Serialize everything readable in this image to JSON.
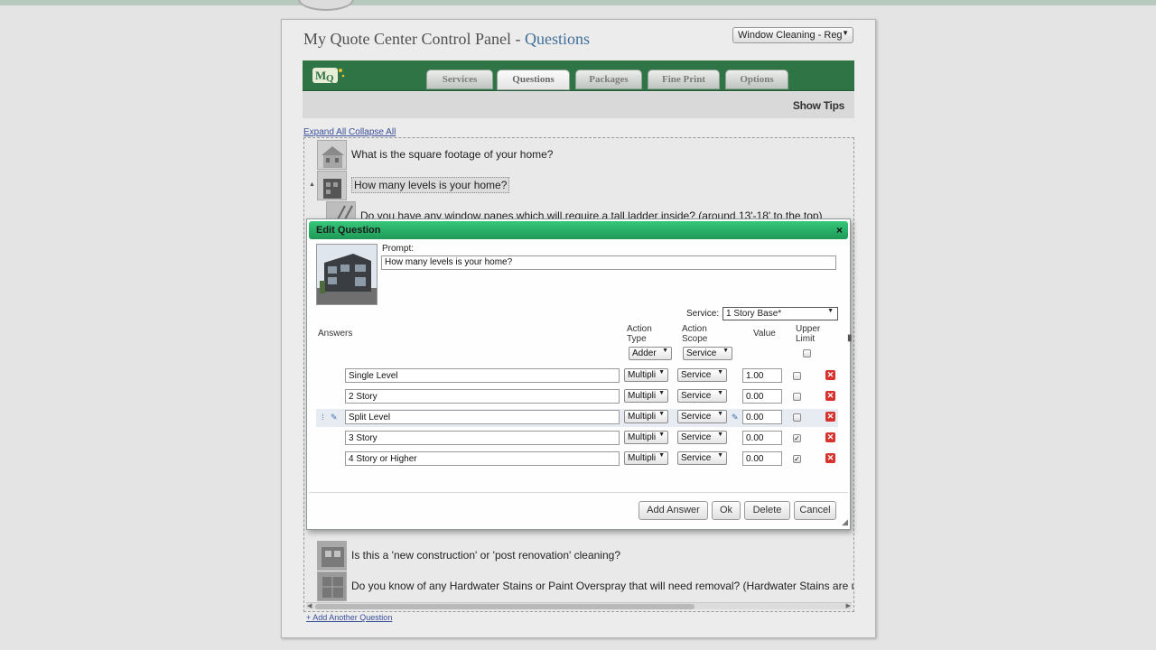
{
  "header": {
    "title_main": "My Quote Center Control Panel - ",
    "title_section": "Questions",
    "service_selector": "Window Cleaning - Reg"
  },
  "nav": {
    "tabs": [
      {
        "label": "Services"
      },
      {
        "label": "Questions",
        "active": true
      },
      {
        "label": "Packages"
      },
      {
        "label": "Fine Print"
      },
      {
        "label": "Options"
      }
    ],
    "show_tips": "Show Tips"
  },
  "list": {
    "expand_all": "Expand All",
    "collapse_all": "Collapse All",
    "questions": [
      "What is the square footage of your home?",
      "How many levels is your home?",
      "Do you have any window panes which will require a tall ladder inside? (around 13'-18' to the top)",
      "Is this a 'new construction' or 'post renovation' cleaning?",
      "Do you know of any Hardwater Stains or Paint Overspray that will need removal? (Hardwater Stains are u"
    ],
    "add_question": "+ Add Another Question"
  },
  "dialog": {
    "title": "Edit Question",
    "close": "×",
    "prompt_label": "Prompt:",
    "prompt_value": "How many levels is your home?",
    "service_label": "Service:",
    "service_value": "1 Story Base*",
    "headers": {
      "answers": "Answers",
      "action_type_1": "Action",
      "action_type_2": "Type",
      "action_scope_1": "Action",
      "action_scope_2": "Scope",
      "value": "Value",
      "upper_limit_1": "Upper",
      "upper_limit_2": "Limit"
    },
    "default_action_type": "Adder",
    "default_action_scope": "Service",
    "answers": [
      {
        "label": "Single Level",
        "type": "Multipli",
        "scope": "Service",
        "value": "1.00",
        "upper": false
      },
      {
        "label": "2 Story",
        "type": "Multipli",
        "scope": "Service",
        "value": "0.00",
        "upper": false
      },
      {
        "label": "Split Level",
        "type": "Multipli",
        "scope": "Service",
        "value": "0.00",
        "upper": false
      },
      {
        "label": "3 Story",
        "type": "Multipli",
        "scope": "Service",
        "value": "0.00",
        "upper": true
      },
      {
        "label": "4 Story or Higher",
        "type": "Multipli",
        "scope": "Service",
        "value": "0.00",
        "upper": true
      }
    ],
    "buttons": {
      "add_answer": "Add Answer",
      "ok": "Ok",
      "delete": "Delete",
      "cancel": "Cancel"
    }
  },
  "colors": {
    "nav_green": "#2f7444",
    "dialog_title_green": "#1e9957",
    "accent_blue": "#3f6f98",
    "delete_red": "#d8322e"
  },
  "icons": [
    "logo-icon",
    "close-icon",
    "caret-down-icon",
    "drag-handle-icon",
    "wrench-icon",
    "delete-x-icon",
    "checkbox-icon",
    "resize-grip-icon"
  ]
}
